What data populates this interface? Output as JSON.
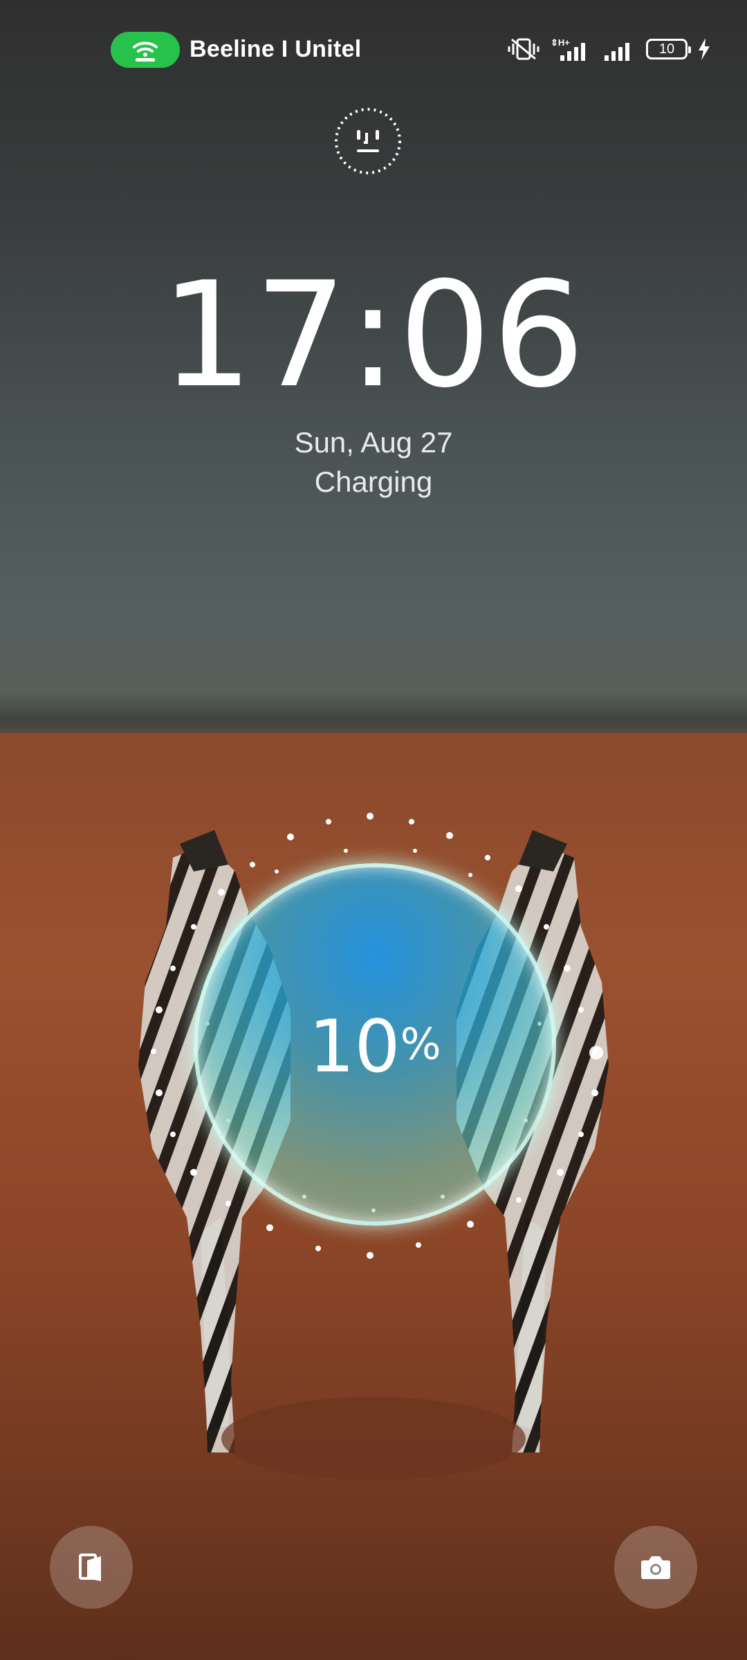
{
  "status_bar": {
    "carrier": "Beeline I Unitel",
    "battery_level": "10",
    "hotspot_color": "#27c24c",
    "icons": [
      "hotspot-icon",
      "vibrate-icon",
      "signal-h-plus-icon",
      "signal-icon",
      "battery-icon",
      "charging-bolt-icon"
    ]
  },
  "lock_screen": {
    "time": "17:06",
    "date": "Sun, Aug 27",
    "status": "Charging"
  },
  "charging": {
    "percent_value": "10",
    "percent_sign": "%",
    "level": 0.1,
    "orb_color": "#1e96e6"
  },
  "shortcuts": {
    "left": "card-switch-icon",
    "right": "camera-icon"
  }
}
